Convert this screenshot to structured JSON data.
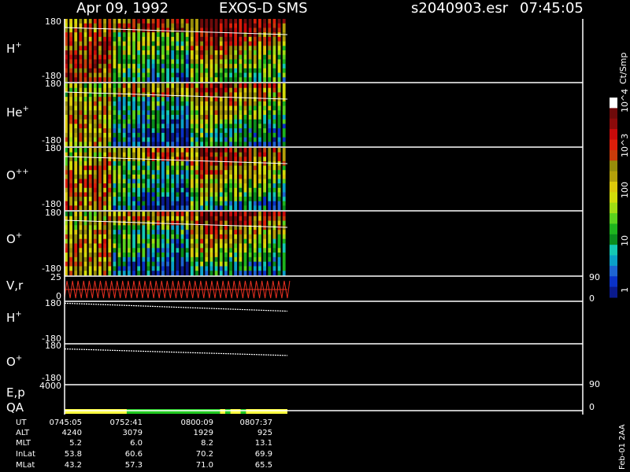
{
  "header": {
    "date": "Apr 09, 1992",
    "mission": "EXOS-D SMS",
    "file": "s2040903.esr",
    "time": "07:45:05"
  },
  "colorbar": {
    "unit": "Ct/Smp",
    "labels": [
      "1",
      "10",
      "100",
      "10^3",
      "10^4"
    ],
    "colors": [
      "#0a1a8c",
      "#0a32c8",
      "#1e64d2",
      "#0aa0c8",
      "#14c8b4",
      "#0a8c1e",
      "#1eb41e",
      "#5ad21e",
      "#a0dc14",
      "#d2dc0a",
      "#dcc80a",
      "#b4a00a",
      "#968c0a",
      "#c83c0a",
      "#dc1e0a",
      "#c80a0a",
      "#8c0a0a",
      "#6e0a0a",
      "#ffffff"
    ]
  },
  "chart_data": [
    {
      "type": "heatmap",
      "panel": "H+",
      "species": {
        "base": "H",
        "sup": "+"
      },
      "ylim": [
        -180,
        180
      ],
      "y_ticks": [
        "180",
        "-180"
      ],
      "x_filled_fraction": [
        0,
        0.43
      ],
      "pattern": "vertical stripes; blue/green minimum early-mid interval, yellow/red maxima at upper right"
    },
    {
      "type": "heatmap",
      "panel": "He+",
      "species": {
        "base": "He",
        "sup": "+"
      },
      "ylim": [
        -180,
        180
      ],
      "y_ticks": [
        "180",
        "-180"
      ],
      "x_filled_fraction": [
        0,
        0.43
      ]
    },
    {
      "type": "heatmap",
      "panel": "O++",
      "species": {
        "base": "O",
        "sup": "++"
      },
      "ylim": [
        -180,
        180
      ],
      "y_ticks": [
        "180",
        "-180"
      ],
      "x_filled_fraction": [
        0,
        0.43
      ]
    },
    {
      "type": "heatmap",
      "panel": "O+",
      "species": {
        "base": "O",
        "sup": "+"
      },
      "ylim": [
        -180,
        180
      ],
      "y_ticks": [
        "180",
        "-180"
      ],
      "x_filled_fraction": [
        0,
        0.43
      ]
    },
    {
      "type": "line",
      "panel": "V,r",
      "label": "V,r",
      "ylim_left": [
        0,
        25
      ],
      "y_ticks_left": [
        "25",
        "0"
      ],
      "y_ticks_right": [
        "90",
        "0"
      ],
      "pattern": "red sawtooth"
    },
    {
      "type": "line",
      "panel": "H+ pitch",
      "species": {
        "base": "H",
        "sup": "+"
      },
      "ylim": [
        -180,
        180
      ],
      "y_ticks": [
        "180",
        "-180"
      ],
      "x": [
        0,
        0.43
      ],
      "y": [
        170,
        100
      ]
    },
    {
      "type": "line",
      "panel": "O+ pitch",
      "species": {
        "base": "O",
        "sup": "+"
      },
      "ylim": [
        -180,
        180
      ],
      "y_ticks": [
        "180",
        "-180"
      ],
      "x": [
        0,
        0.43
      ],
      "y": [
        140,
        80
      ]
    },
    {
      "type": "line",
      "panel": "E,p",
      "label": "E,p",
      "y_ticks_left": [
        "4000"
      ],
      "y_ticks_right": [
        "90"
      ]
    },
    {
      "type": "bar",
      "panel": "QA",
      "label": "QA",
      "y_ticks_right": [
        "0"
      ],
      "segments": [
        {
          "from": 0.0,
          "to": 0.12,
          "color": "#ffff40"
        },
        {
          "from": 0.12,
          "to": 0.3,
          "color": "#20c820"
        },
        {
          "from": 0.3,
          "to": 0.31,
          "color": "#ffff40"
        },
        {
          "from": 0.31,
          "to": 0.32,
          "color": "#20c820"
        },
        {
          "from": 0.32,
          "to": 0.34,
          "color": "#ffff40"
        },
        {
          "from": 0.34,
          "to": 0.35,
          "color": "#20c820"
        },
        {
          "from": 0.35,
          "to": 0.43,
          "color": "#ffff40"
        }
      ]
    }
  ],
  "footer": {
    "row_labels": [
      "UT",
      "ALT",
      "MLT",
      "InLat",
      "MLat"
    ],
    "columns": [
      [
        "0745:05",
        "4240",
        "5.2",
        "53.8",
        "43.2"
      ],
      [
        "0752:41",
        "3079",
        "6.0",
        "60.6",
        "57.3"
      ],
      [
        "0800:09",
        "1929",
        "8.2",
        "70.2",
        "71.0"
      ],
      [
        "0807:37",
        "925",
        "13.1",
        "69.9",
        "65.5"
      ]
    ],
    "stamp": "Feb-01 2AA"
  }
}
